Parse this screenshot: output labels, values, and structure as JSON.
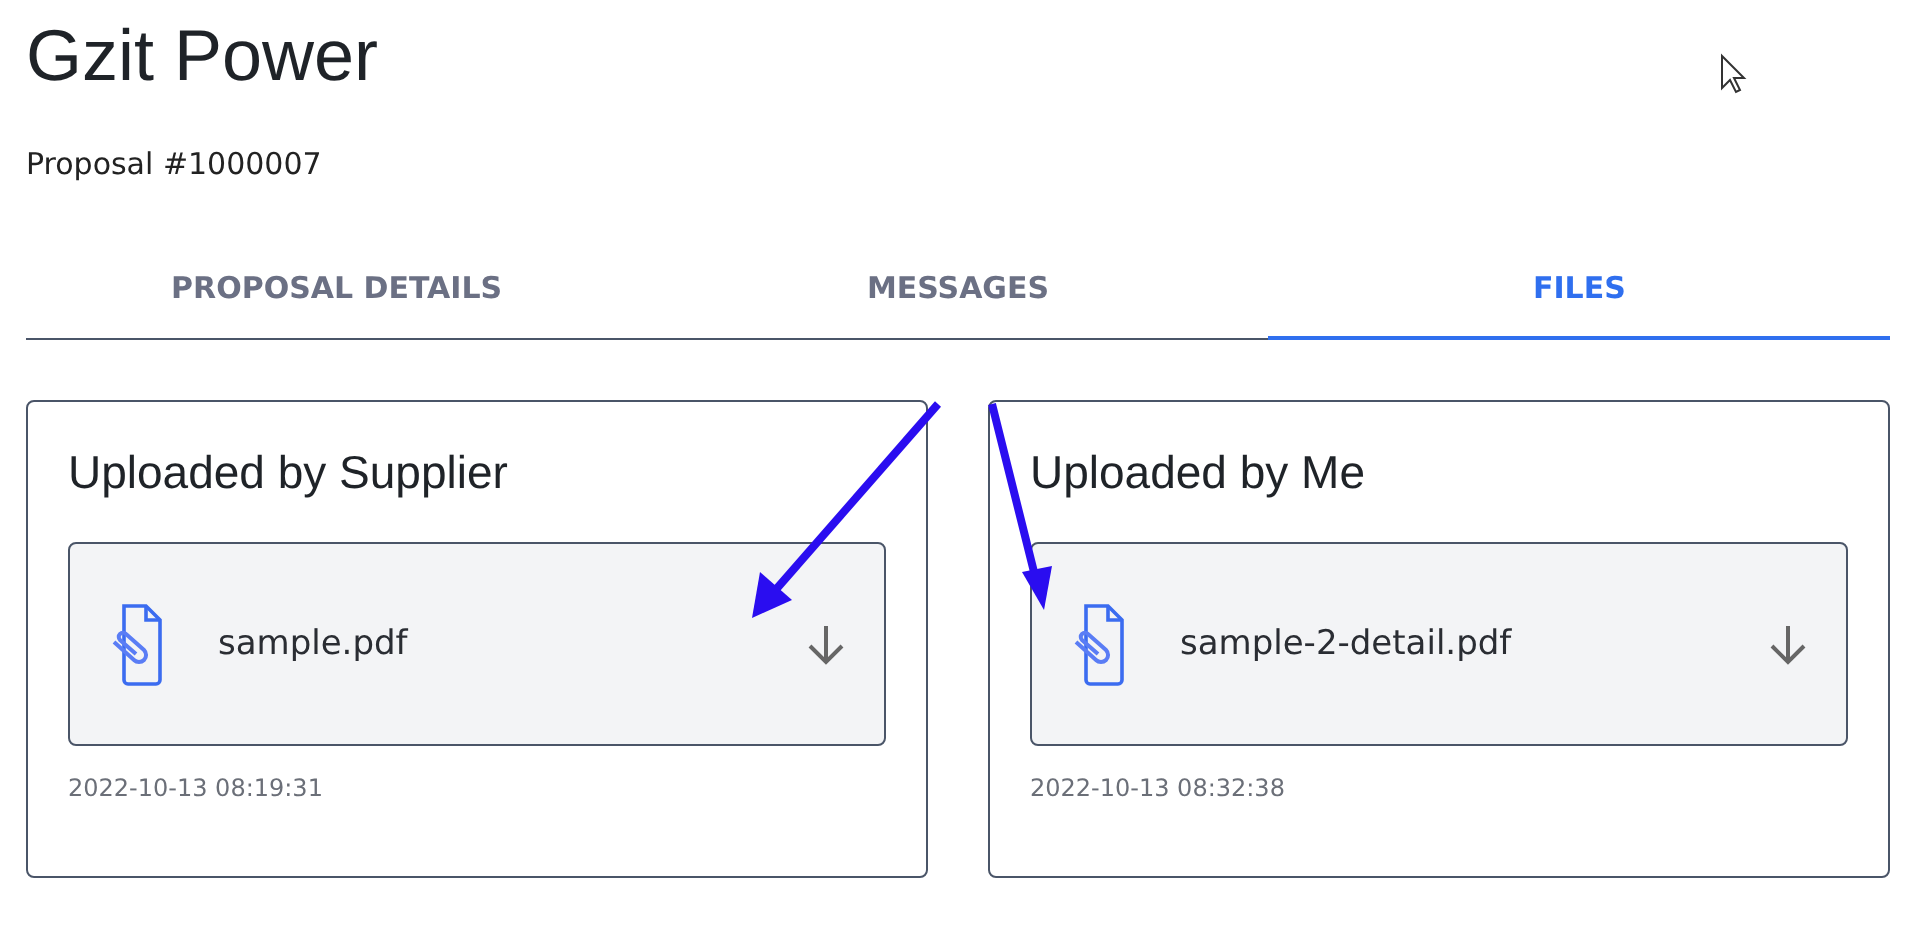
{
  "page": {
    "title": "Gzit Power",
    "subtitle": "Proposal #1000007"
  },
  "tabs": [
    {
      "label": "PROPOSAL DETAILS",
      "selected": false
    },
    {
      "label": "MESSAGES",
      "selected": false
    },
    {
      "label": "FILES",
      "selected": true
    }
  ],
  "panels": [
    {
      "title": "Uploaded by Supplier",
      "files": [
        {
          "name": "sample.pdf",
          "timestamp": "2022-10-13 08:19:31"
        }
      ]
    },
    {
      "title": "Uploaded by Me",
      "files": [
        {
          "name": "sample-2-detail.pdf",
          "timestamp": "2022-10-13 08:32:38"
        }
      ]
    }
  ]
}
